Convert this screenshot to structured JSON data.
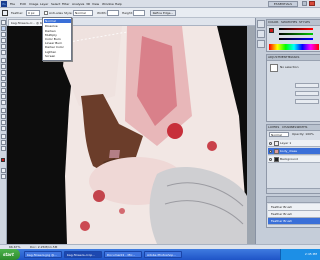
{
  "app": {
    "logo": "Ps",
    "menus": [
      "File",
      "Edit",
      "Image",
      "Layer",
      "Select",
      "Filter",
      "Analysis",
      "3D",
      "View",
      "Window",
      "Help"
    ]
  },
  "options": {
    "tool_value": "Feather:",
    "feather_value": "0 px",
    "anti_alias_label": "Anti-alias",
    "style_label": "Style:",
    "style_value": "Normal",
    "width_label": "Width:",
    "height_label": "Height:",
    "refine_edge_label": "Refine Edge...",
    "workspace_label": "ESSENTIALS"
  },
  "document": {
    "tab_label": "bag-flowers-cr... @ 66.7%",
    "zoom": "66.67%",
    "doc_info": "Doc: 2.25M/11.5M"
  },
  "dropdown": {
    "items": [
      "Normal",
      "Dissolve",
      "Darken",
      "Multiply",
      "Color Burn",
      "Linear Burn",
      "Darker Color",
      "Lighten",
      "Screen"
    ]
  },
  "panels": {
    "color_tabs": [
      "COLOR",
      "SWATCHES",
      "STYLES"
    ],
    "adjust_tabs": [
      "ADJUSTMENTS",
      "MASKS"
    ],
    "adjust_label": "No selection",
    "layers_tabs": [
      "LAYERS",
      "CHANNELS",
      "PATHS"
    ],
    "blend_mode": "Normal",
    "opacity": "Opacity: 100%",
    "layers": [
      {
        "name": "Layer 1",
        "selected": false
      },
      {
        "name": "body_dress",
        "selected": true
      },
      {
        "name": "Background",
        "selected": false
      }
    ],
    "history_items": [
      "Feather Brush",
      "Feather Brush",
      "Feather Brush"
    ]
  },
  "taskbar": {
    "start_label": "start",
    "tasks": [
      {
        "label": "bag-flowers.jpg @...",
        "active": false
      },
      {
        "label": "bag-flowers-crop...",
        "active": true
      },
      {
        "label": "Document1 - Mic...",
        "active": false
      },
      {
        "label": "Adobe Photoshop...",
        "active": false
      }
    ],
    "clock": "2:45 PM"
  },
  "colors": {
    "foreground": "#cc1a1a",
    "background": "#ffffff",
    "accent": "#3a6fd8"
  }
}
